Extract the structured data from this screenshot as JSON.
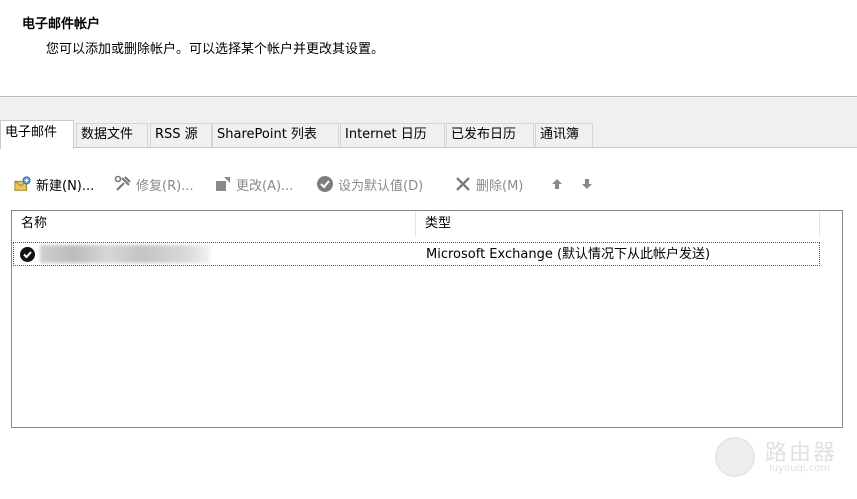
{
  "header": {
    "title": "电子邮件帐户",
    "description": "您可以添加或删除帐户。可以选择某个帐户并更改其设置。"
  },
  "tabs": [
    {
      "label": "电子邮件",
      "active": true
    },
    {
      "label": "数据文件",
      "active": false
    },
    {
      "label": "RSS 源",
      "active": false
    },
    {
      "label": "SharePoint 列表",
      "active": false
    },
    {
      "label": "Internet 日历",
      "active": false
    },
    {
      "label": "已发布日历",
      "active": false
    },
    {
      "label": "通讯簿",
      "active": false
    }
  ],
  "toolbar": {
    "new_label": "新建(N)...",
    "repair_label": "修复(R)...",
    "change_label": "更改(A)...",
    "set_default_label": "设为默认值(D)",
    "remove_label": "删除(M)",
    "move_up_icon": "arrow-up-icon",
    "move_down_icon": "arrow-down-icon"
  },
  "list": {
    "columns": [
      "名称",
      "类型"
    ],
    "rows": [
      {
        "name": "",
        "type": "Microsoft Exchange (默认情况下从此帐户发送)",
        "is_default": true
      }
    ]
  },
  "watermark": {
    "text": "路由器",
    "sub": "luyouqi.com"
  },
  "colors": {
    "header_bg": "#ffffff",
    "window_bg": "#f0f0f0",
    "disabled_text": "#8a8a8a"
  }
}
